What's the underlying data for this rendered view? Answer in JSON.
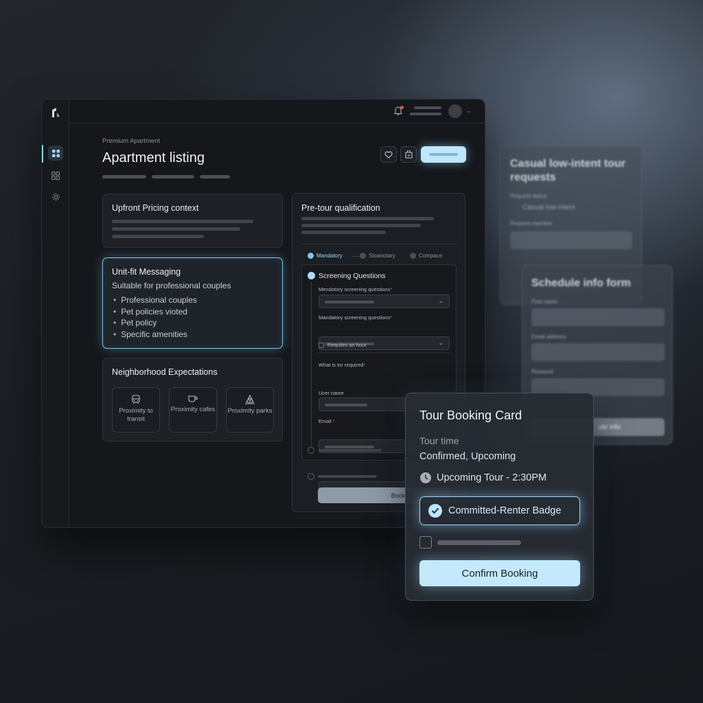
{
  "listing": {
    "eyebrow": "Premium Apartment",
    "title": "Apartment listing"
  },
  "cards": {
    "pricing": {
      "title": "Upfront Pricing context"
    },
    "unit_fit": {
      "title": "Unit-fit Messaging",
      "subtitle": "Suitable for professional couples",
      "items": [
        "Professional couples",
        "Pet policies vioted",
        "Pet policy",
        "Specific amenities"
      ]
    },
    "neighborhood": {
      "title": "Neighborhood Expectations",
      "tiles": [
        {
          "label": "Proximity to transit",
          "icon": "bus-icon"
        },
        {
          "label": "Proximity cafes",
          "icon": "coffee-cup-icon"
        },
        {
          "label": "Proximity parks",
          "icon": "park-tree-icon"
        }
      ]
    }
  },
  "qualification": {
    "title": "Pre-tour qualification",
    "steps": [
      "Mandatory",
      "Stoanotary",
      "Compace"
    ],
    "section_title": "Screening Questions",
    "field1_label": "Mendotory screening questions",
    "field2_label": "Mandatory screening questions",
    "checkbox_label": "Requiles an hour",
    "field3_label": "What is tor required",
    "field4_label": "Ucer name",
    "field5_label": "Email",
    "book_button": "Book tour"
  },
  "ghost_panels": {
    "requests": {
      "title": "Casual low-intent tour requests",
      "status_label": "Request status",
      "status_value": "Casual low-intent",
      "member_label": "Request member"
    },
    "schedule": {
      "title": "Schedule info form",
      "first_name": "First name",
      "email": "Email address",
      "password": "Reseund",
      "button": "ule info"
    }
  },
  "booking": {
    "title": "Tour Booking Card",
    "time_label": "Tour time",
    "status": "Confirmed, Upcoming",
    "upcoming": "Upcoming Tour - 2:30PM",
    "badge": "Committed-Renter Badge",
    "confirm": "Confirm Booking"
  },
  "colors": {
    "accent": "#bfe6fb",
    "glow": "#7fc6ec",
    "alert": "#e0524f"
  }
}
